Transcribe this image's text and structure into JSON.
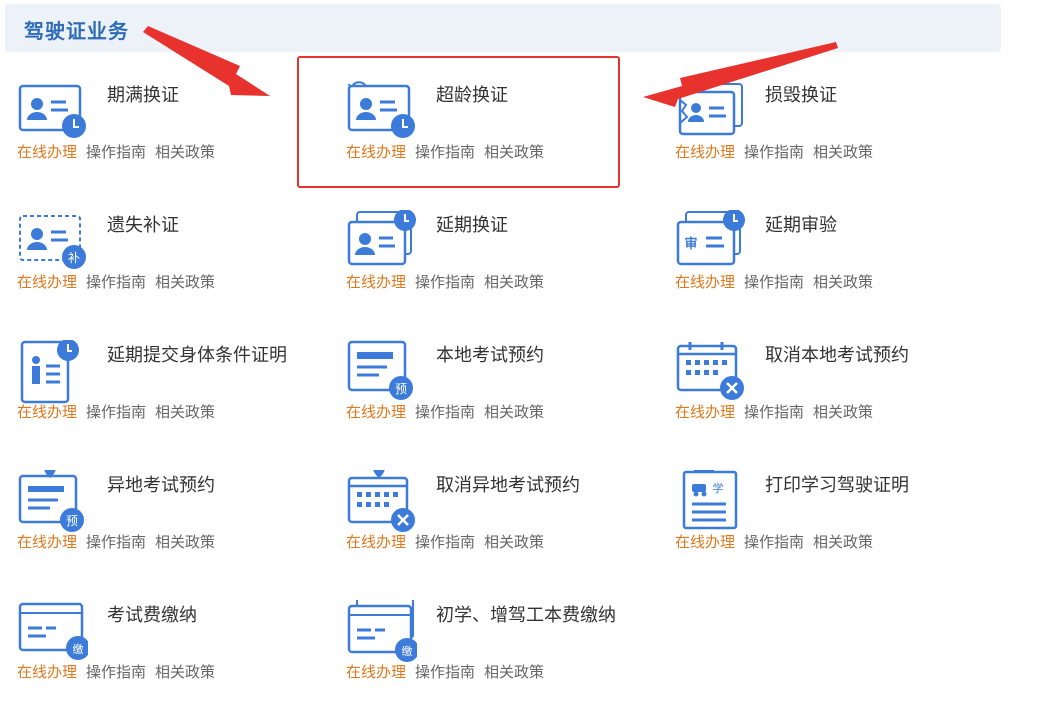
{
  "header": {
    "title": "驾驶证业务"
  },
  "link_labels": {
    "online": "在线办理",
    "guide": "操作指南",
    "policy": "相关政策"
  },
  "colors": {
    "accent": "#2f6db8",
    "icon_blue": "#3c7bd9",
    "link_orange": "#e0781e",
    "highlight_red": "#e8322e"
  },
  "items": [
    {
      "title": "期满换证",
      "icon": "card-clock-icon"
    },
    {
      "title": "超龄换证",
      "icon": "card-refresh-clock-icon"
    },
    {
      "title": "损毁换证",
      "icon": "card-damaged-icon"
    },
    {
      "title": "遗失补证",
      "icon": "card-reissue-icon"
    },
    {
      "title": "延期换证",
      "icon": "card-deferred-icon"
    },
    {
      "title": "延期审验",
      "icon": "card-audit-icon"
    },
    {
      "title": "延期提交身体条件证明",
      "icon": "health-certificate-icon"
    },
    {
      "title": "本地考试预约",
      "icon": "exam-booking-icon"
    },
    {
      "title": "取消本地考试预约",
      "icon": "calendar-cancel-icon"
    },
    {
      "title": "异地考试预约",
      "icon": "remote-exam-booking-icon"
    },
    {
      "title": "取消异地考试预约",
      "icon": "remote-calendar-cancel-icon"
    },
    {
      "title": "打印学习驾驶证明",
      "icon": "learner-permit-print-icon"
    },
    {
      "title": "考试费缴纳",
      "icon": "exam-fee-payment-icon"
    },
    {
      "title": "初学、增驾工本费缴纳",
      "icon": "license-fee-payment-icon"
    }
  ]
}
